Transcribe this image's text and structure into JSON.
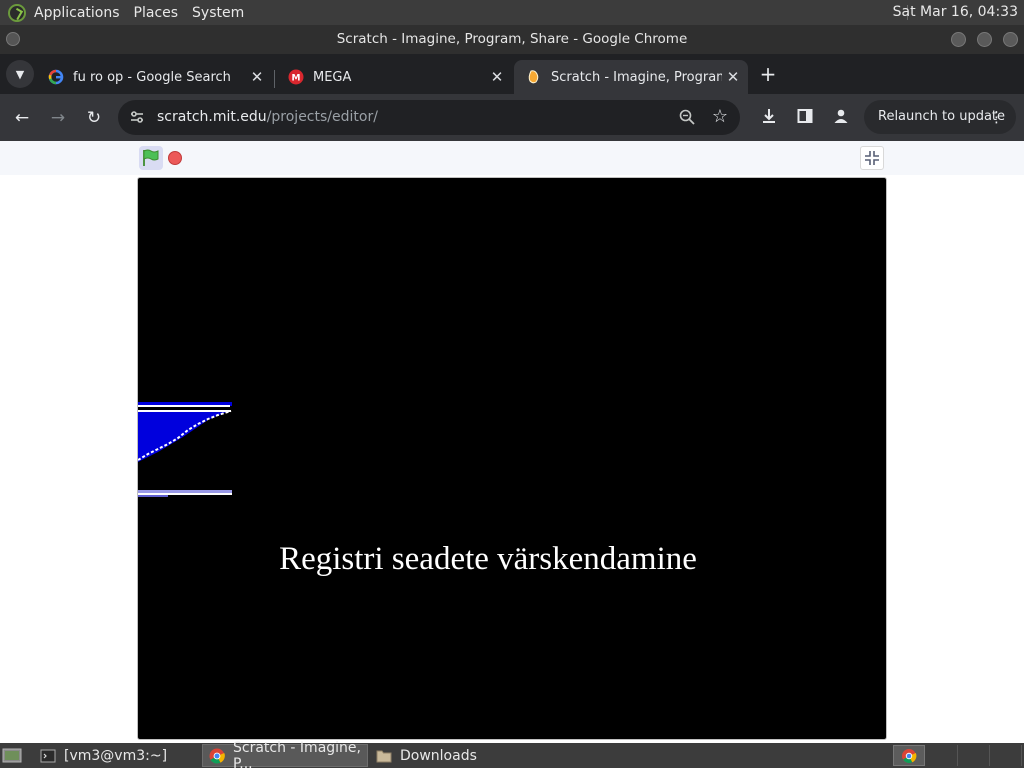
{
  "system_panel": {
    "menus": [
      "Applications",
      "Places",
      "System"
    ],
    "clock": "Sat Mar 16, 04:33"
  },
  "window": {
    "title": "Scratch - Imagine, Program, Share - Google Chrome"
  },
  "tabs": [
    {
      "title": "fu ro op - Google Search",
      "favicon": "google-icon",
      "active": false
    },
    {
      "title": "MEGA",
      "favicon": "mega-icon",
      "active": false
    },
    {
      "title": "Scratch - Imagine, Program, Share",
      "favicon": "scratch-icon",
      "active": true
    }
  ],
  "toolbar": {
    "url_host": "scratch.mit.edu",
    "url_path": "/projects/editor/",
    "relaunch_label": "Relaunch to update"
  },
  "stage": {
    "text": "Registri seadete värskendamine"
  },
  "taskbar": {
    "items": [
      {
        "label": "[vm3@vm3:~]",
        "icon": "terminal-icon",
        "active": false
      },
      {
        "label": "Scratch - Imagine, P...",
        "icon": "chrome-icon",
        "active": true
      },
      {
        "label": "Downloads",
        "icon": "folder-icon",
        "active": false
      }
    ]
  },
  "colors": {
    "panel_bg": "#3c3c3c",
    "chrome_tabstrip": "#202124",
    "chrome_toolbar": "#35363a",
    "stage_bg": "#000000",
    "sprite_blue": "#0000dd"
  }
}
